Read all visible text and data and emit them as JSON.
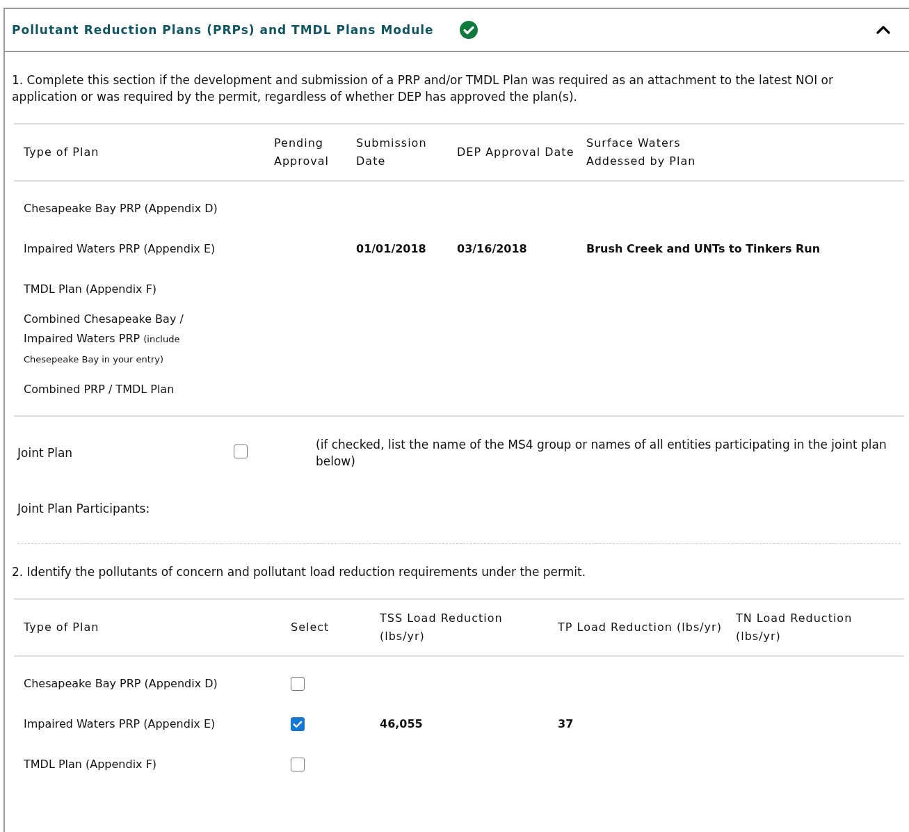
{
  "module": {
    "title": "Pollutant Reduction Plans (PRPs) and TMDL Plans Module",
    "complete": true,
    "expanded": true
  },
  "section_1": {
    "instruction": "1. Complete this section if the development and submission of a PRP and/or TMDL Plan was required as an attachment to the latest NOI or application or was required by the permit, regardless of whether DEP has approved the plan(s).",
    "columns": [
      "Type of Plan",
      "Pending Approval",
      "Submission Date",
      "DEP Approval Date",
      "Surface Waters Addessed by Plan"
    ],
    "rows": [
      {
        "type": "Chesapeake Bay PRP (Appendix D)"
      },
      {
        "type": "Impaired Waters PRP (Appendix E)",
        "submission_date": "01/01/2018",
        "approval_date": "03/16/2018",
        "surface_waters": "Brush Creek and UNTs to Tinkers Run"
      },
      {
        "type": "TMDL Plan (Appendix F)"
      },
      {
        "type": "Combined Chesapeake Bay / Impaired Waters PRP",
        "note": "(include Chesepeake Bay in your entry)"
      },
      {
        "type": "Combined PRP / TMDL Plan"
      }
    ]
  },
  "joint_plan": {
    "label": "Joint Plan",
    "checked": false,
    "hint": "(if checked, list the name of the MS4 group or names of all entities participating in the joint plan below)",
    "participants_label": "Joint Plan Participants:"
  },
  "section_2": {
    "instruction": "2. Identify the pollutants of concern and pollutant load reduction requirements under the permit.",
    "columns": [
      "Type of Plan",
      "Select",
      "TSS Load Reduction (lbs/yr)",
      "TP Load Reduction (lbs/yr)",
      "TN Load Reduction (lbs/yr)"
    ],
    "rows": [
      {
        "type": "Chesapeake Bay PRP (Appendix D)",
        "selected": false
      },
      {
        "type": "Impaired Waters PRP (Appendix E)",
        "selected": true,
        "tss": "46,055",
        "tp": "37"
      },
      {
        "type": "TMDL Plan (Appendix F)",
        "selected": false
      }
    ]
  }
}
